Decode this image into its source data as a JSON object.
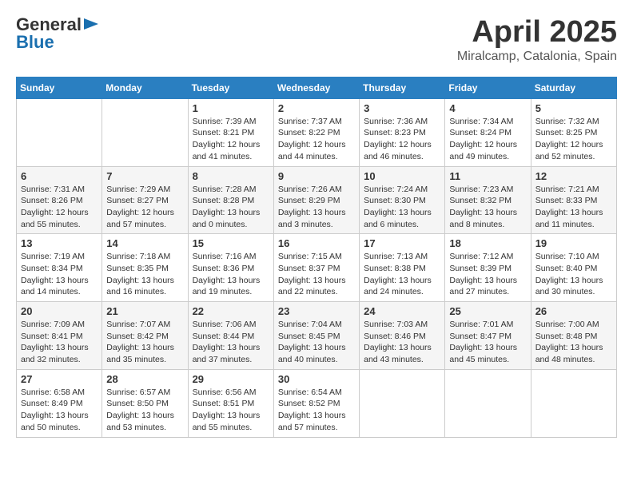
{
  "logo": {
    "line1": "General",
    "line2": "Blue"
  },
  "title": "April 2025",
  "subtitle": "Miralcamp, Catalonia, Spain",
  "days_of_week": [
    "Sunday",
    "Monday",
    "Tuesday",
    "Wednesday",
    "Thursday",
    "Friday",
    "Saturday"
  ],
  "weeks": [
    [
      {
        "day": "",
        "info": ""
      },
      {
        "day": "",
        "info": ""
      },
      {
        "day": "1",
        "info": "Sunrise: 7:39 AM\nSunset: 8:21 PM\nDaylight: 12 hours and 41 minutes."
      },
      {
        "day": "2",
        "info": "Sunrise: 7:37 AM\nSunset: 8:22 PM\nDaylight: 12 hours and 44 minutes."
      },
      {
        "day": "3",
        "info": "Sunrise: 7:36 AM\nSunset: 8:23 PM\nDaylight: 12 hours and 46 minutes."
      },
      {
        "day": "4",
        "info": "Sunrise: 7:34 AM\nSunset: 8:24 PM\nDaylight: 12 hours and 49 minutes."
      },
      {
        "day": "5",
        "info": "Sunrise: 7:32 AM\nSunset: 8:25 PM\nDaylight: 12 hours and 52 minutes."
      }
    ],
    [
      {
        "day": "6",
        "info": "Sunrise: 7:31 AM\nSunset: 8:26 PM\nDaylight: 12 hours and 55 minutes."
      },
      {
        "day": "7",
        "info": "Sunrise: 7:29 AM\nSunset: 8:27 PM\nDaylight: 12 hours and 57 minutes."
      },
      {
        "day": "8",
        "info": "Sunrise: 7:28 AM\nSunset: 8:28 PM\nDaylight: 13 hours and 0 minutes."
      },
      {
        "day": "9",
        "info": "Sunrise: 7:26 AM\nSunset: 8:29 PM\nDaylight: 13 hours and 3 minutes."
      },
      {
        "day": "10",
        "info": "Sunrise: 7:24 AM\nSunset: 8:30 PM\nDaylight: 13 hours and 6 minutes."
      },
      {
        "day": "11",
        "info": "Sunrise: 7:23 AM\nSunset: 8:32 PM\nDaylight: 13 hours and 8 minutes."
      },
      {
        "day": "12",
        "info": "Sunrise: 7:21 AM\nSunset: 8:33 PM\nDaylight: 13 hours and 11 minutes."
      }
    ],
    [
      {
        "day": "13",
        "info": "Sunrise: 7:19 AM\nSunset: 8:34 PM\nDaylight: 13 hours and 14 minutes."
      },
      {
        "day": "14",
        "info": "Sunrise: 7:18 AM\nSunset: 8:35 PM\nDaylight: 13 hours and 16 minutes."
      },
      {
        "day": "15",
        "info": "Sunrise: 7:16 AM\nSunset: 8:36 PM\nDaylight: 13 hours and 19 minutes."
      },
      {
        "day": "16",
        "info": "Sunrise: 7:15 AM\nSunset: 8:37 PM\nDaylight: 13 hours and 22 minutes."
      },
      {
        "day": "17",
        "info": "Sunrise: 7:13 AM\nSunset: 8:38 PM\nDaylight: 13 hours and 24 minutes."
      },
      {
        "day": "18",
        "info": "Sunrise: 7:12 AM\nSunset: 8:39 PM\nDaylight: 13 hours and 27 minutes."
      },
      {
        "day": "19",
        "info": "Sunrise: 7:10 AM\nSunset: 8:40 PM\nDaylight: 13 hours and 30 minutes."
      }
    ],
    [
      {
        "day": "20",
        "info": "Sunrise: 7:09 AM\nSunset: 8:41 PM\nDaylight: 13 hours and 32 minutes."
      },
      {
        "day": "21",
        "info": "Sunrise: 7:07 AM\nSunset: 8:42 PM\nDaylight: 13 hours and 35 minutes."
      },
      {
        "day": "22",
        "info": "Sunrise: 7:06 AM\nSunset: 8:44 PM\nDaylight: 13 hours and 37 minutes."
      },
      {
        "day": "23",
        "info": "Sunrise: 7:04 AM\nSunset: 8:45 PM\nDaylight: 13 hours and 40 minutes."
      },
      {
        "day": "24",
        "info": "Sunrise: 7:03 AM\nSunset: 8:46 PM\nDaylight: 13 hours and 43 minutes."
      },
      {
        "day": "25",
        "info": "Sunrise: 7:01 AM\nSunset: 8:47 PM\nDaylight: 13 hours and 45 minutes."
      },
      {
        "day": "26",
        "info": "Sunrise: 7:00 AM\nSunset: 8:48 PM\nDaylight: 13 hours and 48 minutes."
      }
    ],
    [
      {
        "day": "27",
        "info": "Sunrise: 6:58 AM\nSunset: 8:49 PM\nDaylight: 13 hours and 50 minutes."
      },
      {
        "day": "28",
        "info": "Sunrise: 6:57 AM\nSunset: 8:50 PM\nDaylight: 13 hours and 53 minutes."
      },
      {
        "day": "29",
        "info": "Sunrise: 6:56 AM\nSunset: 8:51 PM\nDaylight: 13 hours and 55 minutes."
      },
      {
        "day": "30",
        "info": "Sunrise: 6:54 AM\nSunset: 8:52 PM\nDaylight: 13 hours and 57 minutes."
      },
      {
        "day": "",
        "info": ""
      },
      {
        "day": "",
        "info": ""
      },
      {
        "day": "",
        "info": ""
      }
    ]
  ]
}
